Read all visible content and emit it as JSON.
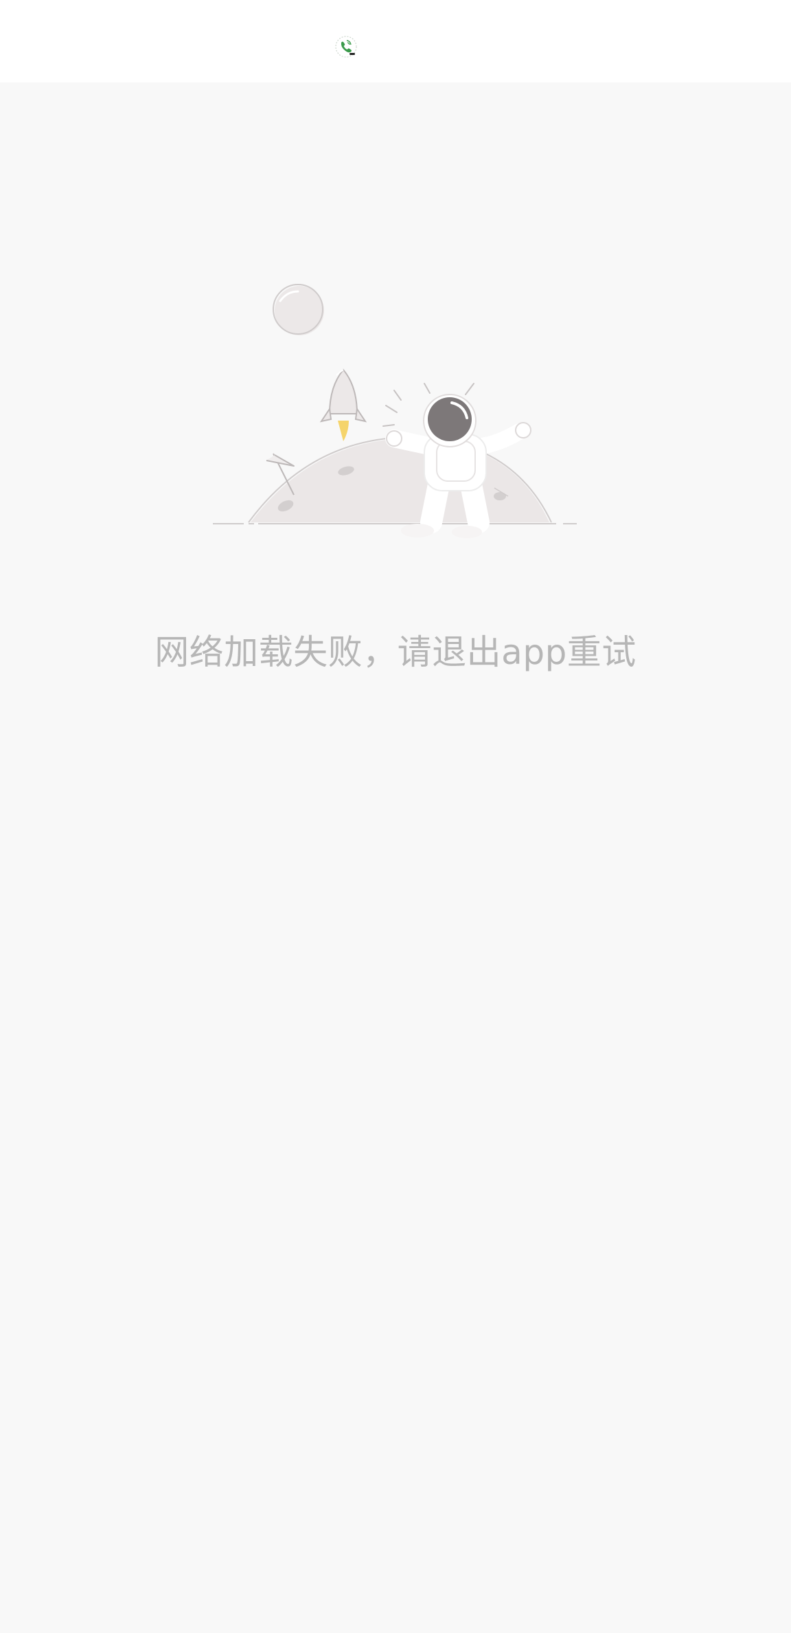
{
  "status_bar": {
    "icon": "phone-call-icon",
    "icon_color": "#3a9a4a"
  },
  "empty_state": {
    "illustration": "astronaut-on-moon-illustration",
    "message": "网络加载失败，请退出app重试",
    "message_color": "#b6b6b6",
    "background_color": "#f8f8f8"
  }
}
